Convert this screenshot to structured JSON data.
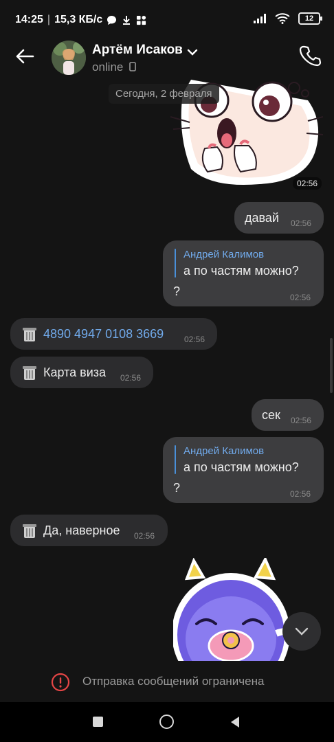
{
  "status_bar": {
    "time": "14:25",
    "speed": "15,3 КБ/с",
    "battery": "12",
    "separator": "|"
  },
  "header": {
    "contact_name": "Артём Исаков",
    "status": "online"
  },
  "chat": {
    "date": "Сегодня, 2 февраля",
    "sticker_top_time": "02:56",
    "messages": [
      {
        "text": "давай",
        "time": "02:56"
      },
      {
        "quote_author": "Андрей Калимов",
        "quote_text": "а по частям можно?",
        "text": "?",
        "time": "02:56"
      },
      {
        "text": "4890 4947 0108 3669",
        "time": "02:56"
      },
      {
        "text": "Карта виза",
        "time": "02:56"
      },
      {
        "text": "сек",
        "time": "02:56"
      },
      {
        "quote_author": "Андрей Калимов",
        "quote_text": "а по частям можно?",
        "text": "?",
        "time": "02:56"
      },
      {
        "text": "Да, наверное",
        "time": "02:56"
      }
    ]
  },
  "footer": {
    "restriction_text": "Отправка сообщений ограничена"
  },
  "colors": {
    "background": "#141414",
    "outgoing_bubble": "#3d3d3f",
    "incoming_bubble": "#2c2c2e",
    "link": "#71aaeb",
    "warning": "#e64646"
  },
  "icons": [
    "back-arrow-icon",
    "chevron-down-icon",
    "phone-icon",
    "mobile-device-icon",
    "trash-icon",
    "chevron-down-scroll-icon",
    "warning-icon",
    "nav-square-icon",
    "nav-circle-icon",
    "nav-triangle-icon"
  ]
}
